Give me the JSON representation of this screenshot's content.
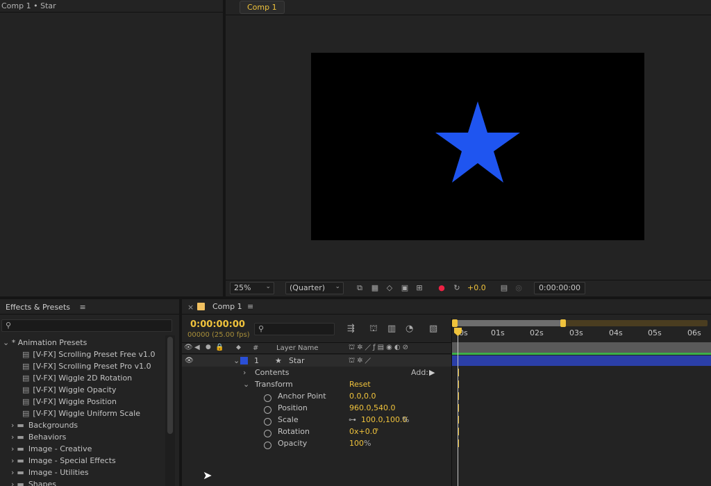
{
  "project_panel": {
    "title": "Comp 1 • Star"
  },
  "viewer": {
    "tab_label": "Comp 1",
    "zoom": "25%",
    "resolution": "(Quarter)",
    "exposure": "+0.0",
    "timecode": "0:00:00:00",
    "star_color": "#1f55f0"
  },
  "effects": {
    "title": "Effects & Presets",
    "search_placeholder": "",
    "root": "* Animation Presets",
    "presets": [
      "[V-FX] Scrolling Preset Free v1.0",
      "[V-FX] Scrolling Preset Pro v1.0",
      "[V-FX] Wiggle 2D Rotation",
      "[V-FX] Wiggle Opacity",
      "[V-FX] Wiggle Position",
      "[V-FX] Wiggle Uniform Scale"
    ],
    "folders": [
      "Backgrounds",
      "Behaviors",
      "Image - Creative",
      "Image - Special Effects",
      "Image - Utilities",
      "Shapes"
    ]
  },
  "timeline": {
    "tab_label": "Comp 1",
    "timecode": "0:00:00:00",
    "frame_info": "00000 (25.00 fps)",
    "col_number": "#",
    "col_layer_name": "Layer Name",
    "layer_number": "1",
    "layer_name": "Star",
    "layer_color": "#2a4fd6",
    "contents": "Contents",
    "add_label": "Add:",
    "transform": "Transform",
    "reset": "Reset",
    "properties": [
      {
        "name": "Anchor Point",
        "value": "0.0,0.0",
        "unit": ""
      },
      {
        "name": "Position",
        "value": "960.0,540.0",
        "unit": ""
      },
      {
        "name": "Scale",
        "value": "100.0,100.0",
        "unit": "%"
      },
      {
        "name": "Rotation",
        "value": "0x+0.0",
        "unit": "°"
      },
      {
        "name": "Opacity",
        "value": "100",
        "unit": "%"
      }
    ],
    "ruler": [
      "0s",
      "01s",
      "02s",
      "03s",
      "04s",
      "05s",
      "06s"
    ]
  }
}
